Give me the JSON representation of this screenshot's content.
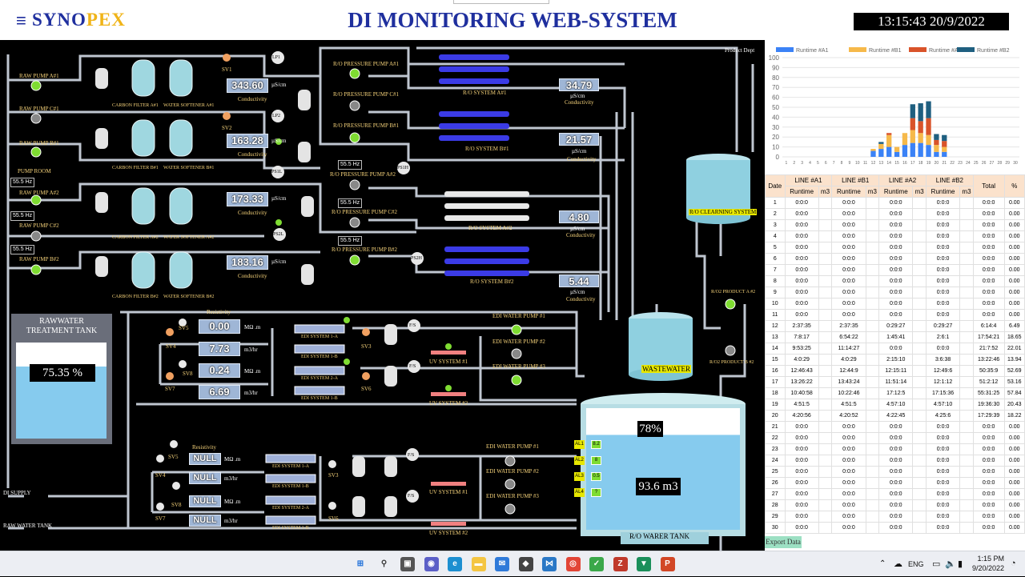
{
  "header": {
    "menu_icon": "hamburger-menu-icon",
    "logo_a": "SYNO",
    "logo_b": "PEX",
    "title": "DI MONITORING WEB-SYSTEM",
    "clock": "13:15:43 20/9/2022"
  },
  "scada": {
    "raw_pumps": [
      "RAW PUMP A#1",
      "RAW PUMP C#1",
      "RAW PUMP B#1",
      "RAW PUMP A#2",
      "RAW PUMP C#2",
      "RAW PUMP B#2"
    ],
    "pump_room": "PUMP ROOM",
    "hz": "55.5 Hz",
    "filters_row1": [
      "CARBON FILTER A#1",
      "WATER SOFTENER A#1"
    ],
    "filters_row2": [
      "CARBON FILTER B#1",
      "WATER SOFTENER B#1"
    ],
    "filters_row3": [
      "CARBON FILTER A#2",
      "WATER SOFTENER A#2"
    ],
    "filters_row4": [
      "CARBON FILTER B#2",
      "WATER SOFTENER B#2"
    ],
    "sv": [
      "SV1",
      "SV2",
      "SV3",
      "SV4",
      "SV5",
      "SV6",
      "SV7",
      "SV8"
    ],
    "lp": [
      "LP1",
      "LP2"
    ],
    "ps": [
      "PS1L",
      "PS2L",
      "PS1H",
      "PS2H"
    ],
    "conductivity_label": "Conductivity",
    "unit_us": "µS/cm",
    "cond_in": [
      "343.60",
      "163.28",
      "173.33",
      "183.16"
    ],
    "cond_out": [
      "34.79",
      "21.57",
      "4.80",
      "5.44"
    ],
    "ro_pumps": [
      "R/O PRESSURE PUMP A#1",
      "R/O PRESSURE PUMP C#1",
      "R/O PRESSURE PUMP B#1",
      "R/O PRESSURE PUMP A#2",
      "R/O PRESSURE PUMP C#2",
      "R/O PRESSURE PUMP B#2"
    ],
    "ro_systems": [
      "R/O SYSTEM A#1",
      "R/O SYSTEM B#1",
      "R/O SYSTEM A#2",
      "R/O SYSTEM B#2"
    ],
    "product_dept": "Product Dept",
    "ro_cleaning": "R/O CLEARNING SYSTEM",
    "wastewater": "WASTEWATER",
    "ro_products": [
      "R/O2 PRODUCT A #2",
      "R/O2 PRODUCT B #2"
    ],
    "raw_tank_title": "RAWWATER TREATMENT TANK",
    "raw_tank_level": "75.35 %",
    "raw_tank_fill": 0.75,
    "resistivity": "Resistivity",
    "mohm": "MΩ .m",
    "m3hr": "m3/hr",
    "edi1_values": [
      "0.00",
      "7.73",
      "0.24",
      "6.69"
    ],
    "edi2_values": [
      "NULL",
      "NULL",
      "NULL",
      "NULL"
    ],
    "edi1_systems": [
      "EDI SYSTEM 1-A",
      "EDI SYSTEM 1-B",
      "EDI SYSTEM 2-A",
      "EDI SYSTEM 1-B"
    ],
    "edi2_systems": [
      "EDI SYSTEM 1-A",
      "EDI SYSTEM 1-B",
      "EDI SYSTEM 2-A",
      "EDI SYSTEM 1-B"
    ],
    "fs": "F/S",
    "uv": [
      "UV SYSTEM #1",
      "UV SYSTEM #2"
    ],
    "edi_pumps": [
      "EDI WATER PUMP #1",
      "EDI WATER PUMP #2",
      "EDI WATER PUMP #3"
    ],
    "ro_tank_pct": "78%",
    "ro_tank_fill": 0.78,
    "ro_tank_vol": "93.6 m3",
    "ro_tank_title": "R/O WARER TANK",
    "alarms": [
      "AL1",
      "AL2",
      "AL3",
      "AL4"
    ],
    "alarm_vals": [
      "8.2",
      "8",
      "0.5",
      "?"
    ],
    "di_supply": "DI SUPPLY",
    "raw_water_tank": "RAW WATER TANK"
  },
  "chart_data": {
    "type": "bar",
    "stacked": true,
    "legend_position": "top",
    "series": [
      {
        "name": "Runtime #A1",
        "color": "#3b82f6",
        "values": [
          0,
          0,
          0,
          0,
          0,
          0,
          0,
          0,
          0,
          0,
          0,
          6,
          8,
          10,
          5,
          12,
          14,
          14,
          12,
          5,
          5,
          0,
          0,
          0,
          0,
          0,
          0,
          0,
          0,
          0
        ]
      },
      {
        "name": "Runtime #B1",
        "color": "#f6b94a",
        "values": [
          0,
          0,
          0,
          0,
          0,
          0,
          0,
          0,
          0,
          0,
          0,
          2,
          5,
          12,
          5,
          12,
          13,
          10,
          10,
          7,
          5,
          0,
          0,
          0,
          0,
          0,
          0,
          0,
          0,
          0
        ]
      },
      {
        "name": "Runtime #A2",
        "color": "#d9532a",
        "values": [
          0,
          0,
          0,
          0,
          0,
          0,
          0,
          0,
          0,
          0,
          0,
          0,
          0,
          2,
          0,
          0,
          12,
          12,
          17,
          5,
          6,
          0,
          0,
          0,
          0,
          0,
          0,
          0,
          0,
          0
        ]
      },
      {
        "name": "Runtime #B2",
        "color": "#1f5f80",
        "values": [
          0,
          0,
          0,
          0,
          0,
          0,
          0,
          0,
          0,
          0,
          0,
          0,
          2,
          0,
          0,
          0,
          14,
          18,
          17,
          6,
          6,
          0,
          0,
          0,
          0,
          0,
          0,
          0,
          0,
          0
        ]
      }
    ],
    "categories": [
      "1",
      "2",
      "3",
      "4",
      "5",
      "6",
      "7",
      "8",
      "9",
      "10",
      "11",
      "12",
      "13",
      "14",
      "15",
      "16",
      "17",
      "18",
      "19",
      "20",
      "21",
      "22",
      "23",
      "24",
      "25",
      "26",
      "27",
      "28",
      "29",
      "30"
    ],
    "ylim": [
      0,
      100
    ],
    "yticks": [
      "0",
      "10",
      "20",
      "30",
      "40",
      "50",
      "60",
      "70",
      "80",
      "90",
      "100"
    ]
  },
  "table": {
    "headers": {
      "date": "Date",
      "a1": "LINE #A1",
      "b1": "LINE #B1",
      "a2": "LINE #A2",
      "b2": "LINE #B2",
      "total": "Total",
      "pct": "%",
      "runtime": "Runtime",
      "m3": "m3"
    },
    "rows": [
      [
        "1",
        "0:0:0",
        "0:0:0",
        "0:0:0",
        "0:0:0",
        "0:0:0",
        "0.00"
      ],
      [
        "2",
        "0:0:0",
        "0:0:0",
        "0:0:0",
        "0:0:0",
        "0:0:0",
        "0.00"
      ],
      [
        "3",
        "0:0:0",
        "0:0:0",
        "0:0:0",
        "0:0:0",
        "0:0:0",
        "0.00"
      ],
      [
        "4",
        "0:0:0",
        "0:0:0",
        "0:0:0",
        "0:0:0",
        "0:0:0",
        "0.00"
      ],
      [
        "5",
        "0:0:0",
        "0:0:0",
        "0:0:0",
        "0:0:0",
        "0:0:0",
        "0.00"
      ],
      [
        "6",
        "0:0:0",
        "0:0:0",
        "0:0:0",
        "0:0:0",
        "0:0:0",
        "0.00"
      ],
      [
        "7",
        "0:0:0",
        "0:0:0",
        "0:0:0",
        "0:0:0",
        "0:0:0",
        "0.00"
      ],
      [
        "8",
        "0:0:0",
        "0:0:0",
        "0:0:0",
        "0:0:0",
        "0:0:0",
        "0.00"
      ],
      [
        "9",
        "0:0:0",
        "0:0:0",
        "0:0:0",
        "0:0:0",
        "0:0:0",
        "0.00"
      ],
      [
        "10",
        "0:0:0",
        "0:0:0",
        "0:0:0",
        "0:0:0",
        "0:0:0",
        "0.00"
      ],
      [
        "11",
        "0:0:0",
        "0:0:0",
        "0:0:0",
        "0:0:0",
        "0:0:0",
        "0.00"
      ],
      [
        "12",
        "2:37:35",
        "2:37:35",
        "0:29:27",
        "0:29:27",
        "6:14:4",
        "6.49"
      ],
      [
        "13",
        "7:8:17",
        "6:54:22",
        "1:45:41",
        "2:6:1",
        "17:54:21",
        "18.65"
      ],
      [
        "14",
        "9:53:25",
        "11:14:27",
        "0:0:0",
        "0:0:0",
        "21:7:52",
        "22.01"
      ],
      [
        "15",
        "4:0:29",
        "4:0:29",
        "2:15:10",
        "3:6:38",
        "13:22:46",
        "13.94"
      ],
      [
        "16",
        "12:46:43",
        "12:44:9",
        "12:15:11",
        "12:49:6",
        "50:35:9",
        "52.69"
      ],
      [
        "17",
        "13:26:22",
        "13:43:24",
        "11:51:14",
        "12:1:12",
        "51:2:12",
        "53.16"
      ],
      [
        "18",
        "10:40:58",
        "10:22:46",
        "17:12:5",
        "17:15:36",
        "55:31:25",
        "57.84"
      ],
      [
        "19",
        "4:51:5",
        "4:51:5",
        "4:57:10",
        "4:57:10",
        "19:36:30",
        "20.43"
      ],
      [
        "20",
        "4:20:56",
        "4:20:52",
        "4:22:45",
        "4:25:6",
        "17:29:39",
        "18.22"
      ],
      [
        "21",
        "0:0:0",
        "0:0:0",
        "0:0:0",
        "0:0:0",
        "0:0:0",
        "0.00"
      ],
      [
        "22",
        "0:0:0",
        "0:0:0",
        "0:0:0",
        "0:0:0",
        "0:0:0",
        "0.00"
      ],
      [
        "23",
        "0:0:0",
        "0:0:0",
        "0:0:0",
        "0:0:0",
        "0:0:0",
        "0.00"
      ],
      [
        "24",
        "0:0:0",
        "0:0:0",
        "0:0:0",
        "0:0:0",
        "0:0:0",
        "0.00"
      ],
      [
        "25",
        "0:0:0",
        "0:0:0",
        "0:0:0",
        "0:0:0",
        "0:0:0",
        "0.00"
      ],
      [
        "26",
        "0:0:0",
        "0:0:0",
        "0:0:0",
        "0:0:0",
        "0:0:0",
        "0.00"
      ],
      [
        "27",
        "0:0:0",
        "0:0:0",
        "0:0:0",
        "0:0:0",
        "0:0:0",
        "0.00"
      ],
      [
        "28",
        "0:0:0",
        "0:0:0",
        "0:0:0",
        "0:0:0",
        "0:0:0",
        "0.00"
      ],
      [
        "29",
        "0:0:0",
        "0:0:0",
        "0:0:0",
        "0:0:0",
        "0:0:0",
        "0.00"
      ],
      [
        "30",
        "0:0:0",
        "0:0:0",
        "0:0:0",
        "0:0:0",
        "0:0:0",
        "0.00"
      ]
    ],
    "export": "Export Data"
  },
  "taskbar": {
    "icons": [
      "windows-start-icon",
      "search-icon",
      "task-view-icon",
      "teams-chat-icon",
      "edge-browser-icon",
      "file-explorer-icon",
      "mail-icon",
      "app-icon",
      "vscode-icon",
      "chrome-icon",
      "app-green-icon",
      "filezilla-icon",
      "app-icon-2",
      "powerpoint-icon"
    ],
    "lang": "ENG",
    "time": "1:15 PM",
    "date": "9/20/2022"
  }
}
